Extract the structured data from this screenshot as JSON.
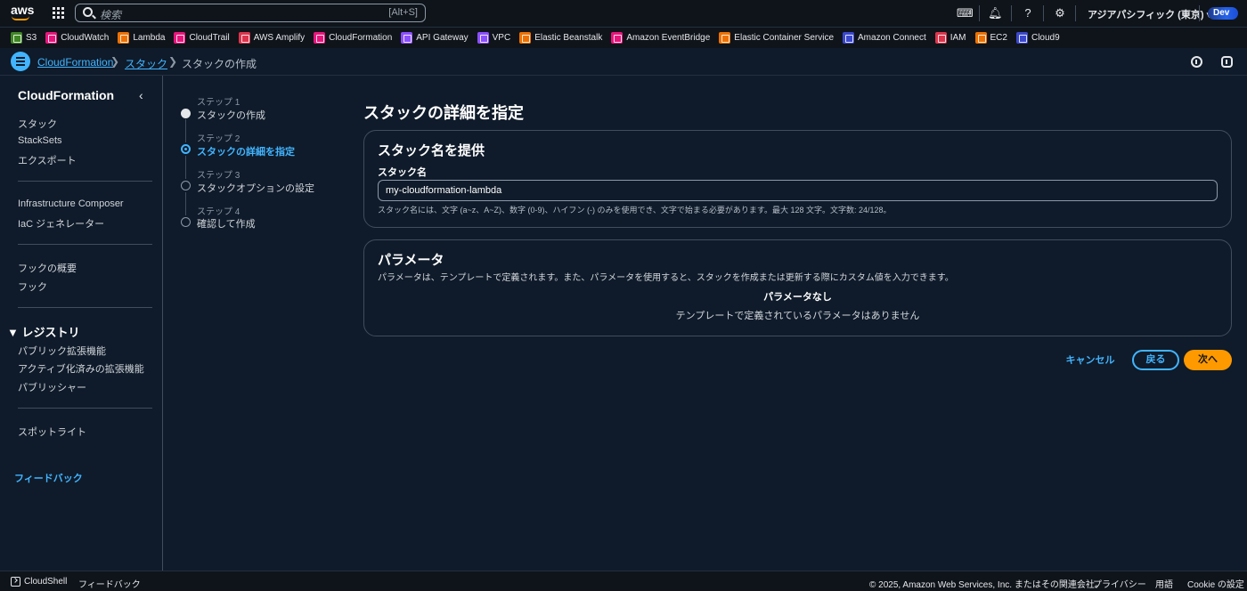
{
  "topbar": {
    "logo": "aws",
    "search_placeholder": "検索",
    "search_shortcut": "[Alt+S]",
    "region": "アジアパシフィック (東京) ▾",
    "account_badge": "Dev",
    "icons": [
      "cloudshell-icon",
      "bell-icon",
      "help-icon",
      "settings-icon"
    ]
  },
  "favorites": [
    {
      "label": "S3",
      "color": "#3f8624"
    },
    {
      "label": "CloudWatch",
      "color": "#e7157b"
    },
    {
      "label": "Lambda",
      "color": "#ed7100"
    },
    {
      "label": "CloudTrail",
      "color": "#e7157b"
    },
    {
      "label": "AWS Amplify",
      "color": "#dd344c"
    },
    {
      "label": "CloudFormation",
      "color": "#e7157b"
    },
    {
      "label": "API Gateway",
      "color": "#8c4fff"
    },
    {
      "label": "VPC",
      "color": "#8c4fff"
    },
    {
      "label": "Elastic Beanstalk",
      "color": "#ed7100"
    },
    {
      "label": "Amazon EventBridge",
      "color": "#e7157b"
    },
    {
      "label": "Elastic Container Service",
      "color": "#ed7100"
    },
    {
      "label": "Amazon Connect",
      "color": "#3b48cc"
    },
    {
      "label": "IAM",
      "color": "#dd344c"
    },
    {
      "label": "EC2",
      "color": "#ed7100"
    },
    {
      "label": "Cloud9",
      "color": "#3b48cc"
    }
  ],
  "breadcrumb": {
    "items": [
      "CloudFormation",
      "スタック",
      "スタックの作成"
    ]
  },
  "sidebar": {
    "title": "CloudFormation",
    "group1": [
      "スタック",
      "StackSets",
      "エクスポート"
    ],
    "group2": [
      "Infrastructure Composer",
      "IaC ジェネレーター"
    ],
    "group3": [
      "フックの概要",
      "フック"
    ],
    "registry_heading": "▼ レジストリ",
    "group4": [
      "パブリック拡張機能",
      "アクティブ化済みの拡張機能",
      "パブリッシャー"
    ],
    "group5": [
      "スポットライト"
    ],
    "feedback": "フィードバック"
  },
  "steps": [
    {
      "label": "ステップ 1",
      "name": "スタックの作成",
      "state": "done"
    },
    {
      "label": "ステップ 2",
      "name": "スタックの詳細を指定",
      "state": "active"
    },
    {
      "label": "ステップ 3",
      "name": "スタックオプションの設定",
      "state": "todo"
    },
    {
      "label": "ステップ 4",
      "name": "確認して作成",
      "state": "todo"
    }
  ],
  "main": {
    "title": "スタックの詳細を指定",
    "stack_name_panel": {
      "title": "スタック名を提供",
      "field_label": "スタック名",
      "value": "my-cloudformation-lambda",
      "hint": "スタック名には、文字 (a~z、A~Z)、数字 (0-9)、ハイフン (-) のみを使用でき、文字で始まる必要があります。最大 128 文字。文字数:   24/128。"
    },
    "params_panel": {
      "title": "パラメータ",
      "description": "パラメータは、テンプレートで定義されます。また、パラメータを使用すると、スタックを作成または更新する際にカスタム値を入力できます。",
      "empty_title": "パラメータなし",
      "empty_desc": "テンプレートで定義されているパラメータはありません"
    },
    "buttons": {
      "cancel": "キャンセル",
      "back": "戻る",
      "next": "次へ"
    }
  },
  "footer": {
    "cloudshell": "CloudShell",
    "feedback": "フィードバック",
    "copyright": "© 2025, Amazon Web Services, Inc. またはその関連会社。",
    "privacy": "プライバシー",
    "terms": "用語",
    "cookie": "Cookie の設定"
  }
}
